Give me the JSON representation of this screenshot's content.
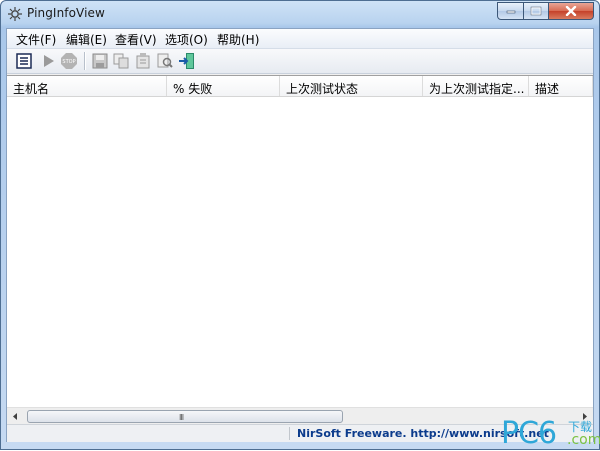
{
  "window": {
    "title": "PingInfoView"
  },
  "menu": [
    "文件(F)",
    "编辑(E)",
    "查看(V)",
    "选项(O)",
    "帮助(H)"
  ],
  "toolbar": {
    "buttons": [
      "list-icon",
      "play-icon",
      "stop-icon",
      "save-icon",
      "copy-icon",
      "properties-icon",
      "find-icon",
      "exit-icon"
    ]
  },
  "list": {
    "columns": [
      "主机名",
      "% 失败",
      "上次测试状态",
      "为上次测试指定...",
      "描述"
    ],
    "rows": []
  },
  "hscroll": {
    "grip": "III"
  },
  "status": {
    "text": "NirSoft Freeware.  http://www.nirsoft.net"
  },
  "watermark": {
    "pc": "PC6",
    "cn": "下载",
    "com": ".com"
  },
  "colors": {
    "title_bg": "#b9d3ef",
    "status_link": "#0b3b8c",
    "watermark": "#2fa7d8"
  }
}
